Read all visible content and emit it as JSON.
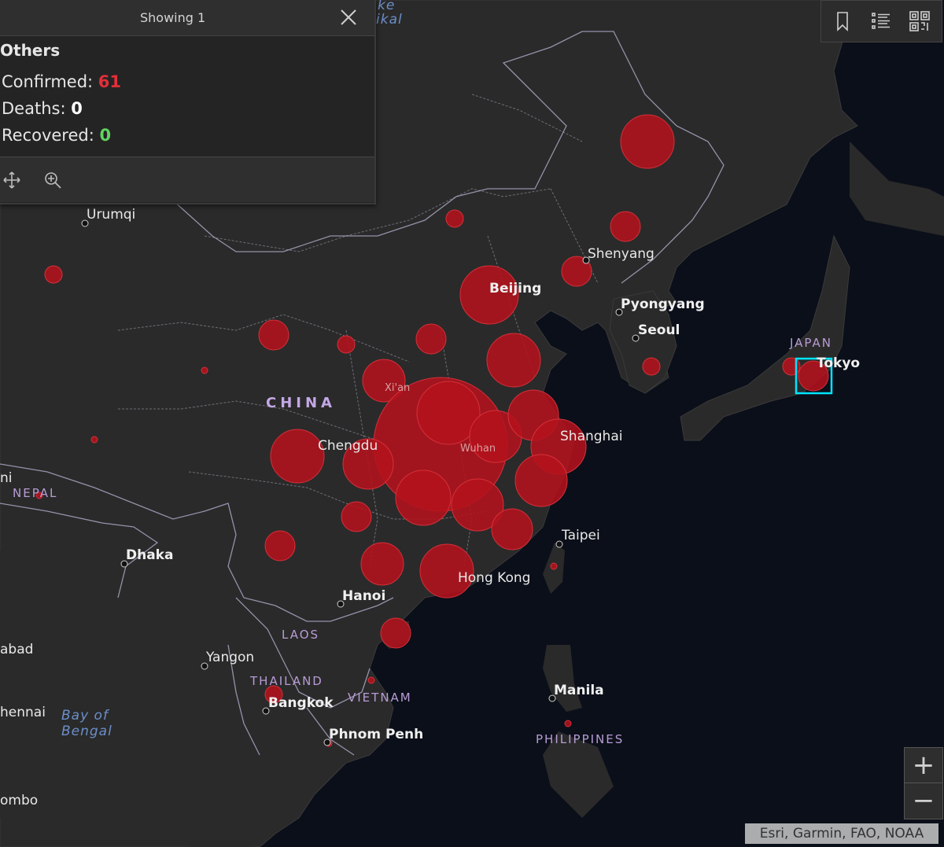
{
  "popup": {
    "header": "Showing 1",
    "name": "Others",
    "confirmed_label": "Confirmed: ",
    "confirmed_value": "61",
    "deaths_label": "Deaths: ",
    "deaths_value": "0",
    "recovered_label": "Recovered: ",
    "recovered_value": "0"
  },
  "map_labels": {
    "urumqi": "Urumqi",
    "shenyang": "Shenyang",
    "beijing": "Beijing",
    "pyongyang": "Pyongyang",
    "seoul": "Seoul",
    "japan": "JAPAN",
    "tokyo": "Tokyo",
    "china": "CHINA",
    "xian": "Xi'an",
    "chengdu": "Chengdu",
    "wuhan": "Wuhan",
    "shanghai": "Shanghai",
    "nepal": "NEPAL",
    "taipei": "Taipei",
    "dhaka": "Dhaka",
    "hongkong": "Hong Kong",
    "hanoi": "Hanoi",
    "laos": "LAOS",
    "yangon": "Yangon",
    "thailand": "THAILAND",
    "bangkok": "Bangkok",
    "vietnam": "VIETNAM",
    "manila": "Manila",
    "bay_of": "Bay of",
    "bengal": "Bengal",
    "phnompenh": "Phnom Penh",
    "philippines": "PHILIPPINES",
    "chennai": "hennai",
    "colombo": "ombo",
    "hyderabad": "abad",
    "kathmandu": "ni",
    "baikal1": "ke",
    "baikal2": "ikal"
  },
  "attribution": "Esri, Garmin, FAO, NOAA",
  "controls": {
    "zoom_in": "+",
    "zoom_out": "−"
  },
  "icons": {
    "close": "close-icon",
    "pan": "pan-icon",
    "zoom_to": "zoom-to-icon",
    "bookmark": "bookmark-icon",
    "list": "list-icon",
    "qr": "qr-code-icon"
  },
  "colors": {
    "case_bubble": "#b3121d",
    "selection": "#00e5ff",
    "confirmed": "#e0303a",
    "recovered": "#5fd35f"
  }
}
